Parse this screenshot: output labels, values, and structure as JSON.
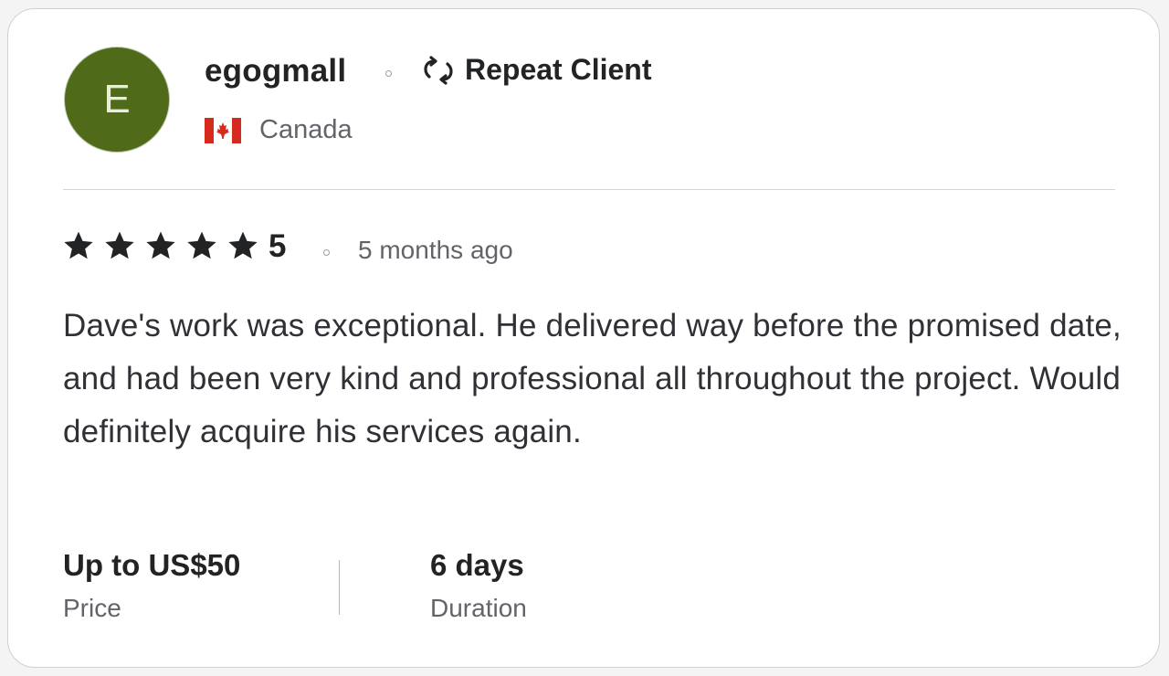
{
  "reviewer": {
    "avatar_letter": "E",
    "avatar_color": "#4f6a18",
    "username": "egogmall",
    "badge_icon": "repeat-icon",
    "badge_label": "Repeat Client",
    "country_flag": "canada-flag-icon",
    "country": "Canada"
  },
  "rating": {
    "stars": 5,
    "max_stars": 5,
    "value": "5",
    "time_ago": "5 months ago"
  },
  "review": {
    "text": "Dave's work was exceptional. He delivered way before the promised date, and had been very kind and professional all throughout the project. Would definitely acquire his services again."
  },
  "stats": {
    "price_value": "Up to US$50",
    "price_label": "Price",
    "duration_value": "6 days",
    "duration_label": "Duration"
  },
  "colors": {
    "text_primary": "#222325",
    "text_secondary": "#62646a",
    "card_border": "#cfd0d3",
    "flag_red": "#d52b1e"
  }
}
